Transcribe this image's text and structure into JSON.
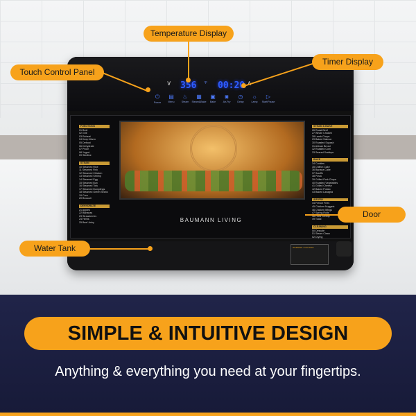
{
  "callouts": {
    "temperature": "Temperature Display",
    "touch_panel": "Touch Control Panel",
    "timer": "Timer Display",
    "door": "Door",
    "water_tank": "Water Tank"
  },
  "display": {
    "temperature": "356",
    "temp_unit": "°F",
    "timer": "00:20"
  },
  "controls": [
    {
      "label": "Power",
      "icon": "power-icon"
    },
    {
      "label": "Menu",
      "icon": "menu-icon"
    },
    {
      "label": "Steam",
      "icon": "steam-icon"
    },
    {
      "label": "Steam&Bake",
      "icon": "steam-bake-icon"
    },
    {
      "label": "Bake",
      "icon": "bake-icon"
    },
    {
      "label": "Air-Fry",
      "icon": "air-fry-icon"
    },
    {
      "label": "Delay",
      "icon": "clock-icon"
    },
    {
      "label": "Lamp",
      "icon": "lamp-icon"
    },
    {
      "label": "Start/Pause",
      "icon": "play-pause-icon"
    }
  ],
  "brand": "BAUMANN LIVING",
  "menu_left": [
    {
      "title": "FUNCTIONS",
      "items": [
        "01 Broil",
        "02 Grill",
        "03 Reheat",
        "04 Keep Warm",
        "05 Defrost",
        "06 Dehydrate",
        "07 Proof",
        "08 Yogurt",
        "09 Sterilize"
      ]
    },
    {
      "title": "STEAM",
      "items": [
        "10 Steamed Rice",
        "11 Steamed Fish",
        "12 Steamed Chicken",
        "13 Steamed Shrimp",
        "14 Steamed Egg",
        "15 Steamed Bun",
        "16 Steamed Tofu",
        "17 Steamed Dumplings",
        "18 Steamed Green Beans",
        "19 Corn",
        "20 Broccoli"
      ]
    },
    {
      "title": "DEHYDRATE",
      "items": [
        "21 Apples",
        "22 Bananas",
        "23 Strawberries",
        "24 Herbs",
        "25 Beef Jerky"
      ]
    }
  ],
  "menu_right": [
    {
      "title": "STEAM & BAKE",
      "items": [
        "26 Roast Beef",
        "27 Whole Chicken",
        "28 Lamb Chops",
        "29 Baked Salmon",
        "30 Roasted Squash",
        "31 Artisan Bread",
        "32 Roasted Corn",
        "33 Seared Scallops"
      ]
    },
    {
      "title": "BAKE",
      "items": [
        "34 Cookies",
        "35 Chiffon Cake",
        "36 Banana Cake",
        "37 Souffle",
        "38 Pizza",
        "39 Grilled Pork Chops",
        "40 Roasted Vegetables",
        "41 Grilled Cheese",
        "42 Baked Potato",
        "43 Baked Lasagna"
      ]
    },
    {
      "title": "AIR FRY",
      "items": [
        "44 French Fries",
        "45 Chicken Nuggets",
        "46 Chicken Wings",
        "47 Spring Rolls",
        "48 Fried Shrimp",
        "49 Toast"
      ]
    },
    {
      "title": "CLEANING",
      "items": [
        "50 Descale",
        "51 Steam Clean",
        "52 Drying"
      ]
    }
  ],
  "warning_label": "WARNING / CAUTION",
  "headline": "SIMPLE & INTUITIVE DESIGN",
  "subheadline": "Anything & everything you need at your fingertips.",
  "colors": {
    "accent": "#f7a21b",
    "background_bottom": "#1e2245",
    "display": "#2f5dff"
  }
}
